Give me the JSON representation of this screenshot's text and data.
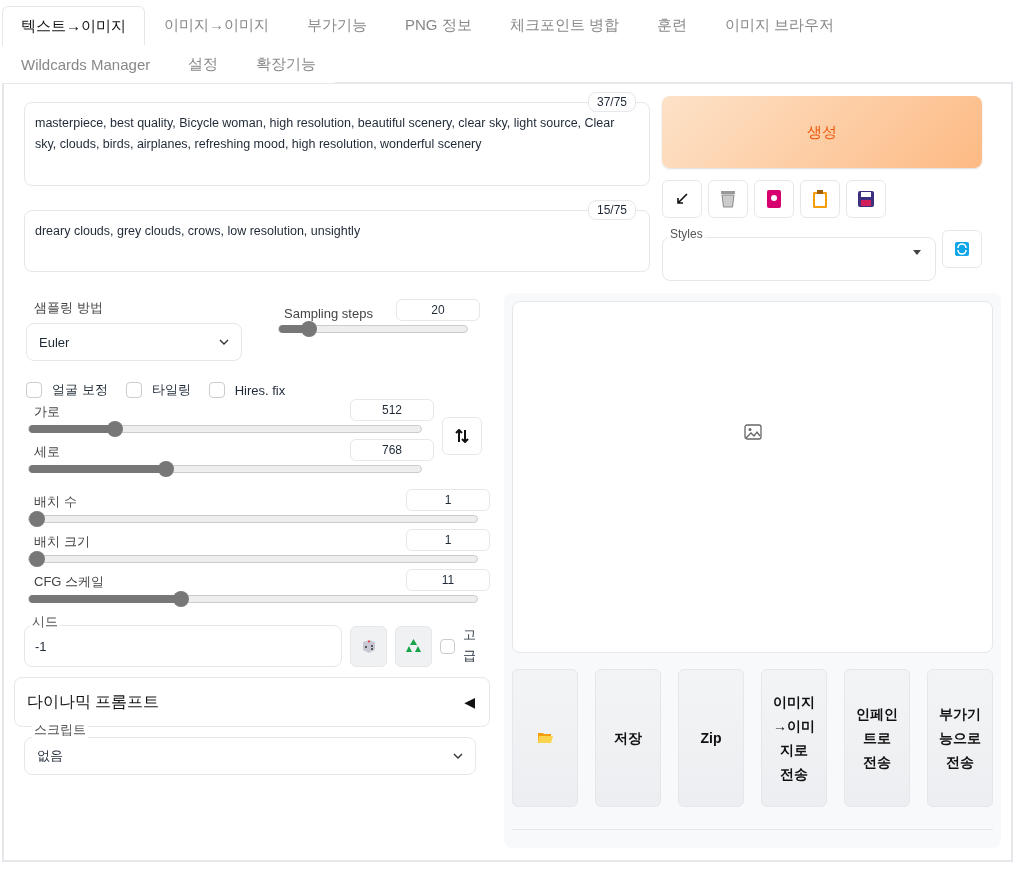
{
  "tabs": [
    {
      "label": "텍스트→이미지",
      "selected": true
    },
    {
      "label": "이미지→이미지",
      "selected": false
    },
    {
      "label": "부가기능",
      "selected": false
    },
    {
      "label": "PNG 정보",
      "selected": false
    },
    {
      "label": "체크포인트 병합",
      "selected": false
    },
    {
      "label": "훈련",
      "selected": false
    },
    {
      "label": "이미지 브라우저",
      "selected": false
    },
    {
      "label": "Wildcards Manager",
      "selected": false
    },
    {
      "label": "설정",
      "selected": false
    },
    {
      "label": "확장기능",
      "selected": false
    }
  ],
  "prompt": {
    "value": "masterpiece, best quality, Bicycle woman, high resolution, beautiful scenery, clear sky, light source, Clear sky, clouds, birds, airplanes, refreshing mood, high resolution, wonderful scenery",
    "count": "37/75"
  },
  "negative_prompt": {
    "value": "dreary clouds, grey clouds, crows, low resolution, unsightly",
    "count": "15/75"
  },
  "generate_button": "생성",
  "tool_buttons": [
    {
      "kind": "arrow"
    },
    {
      "kind": "trash"
    },
    {
      "kind": "card"
    },
    {
      "kind": "clipboard"
    },
    {
      "kind": "disk"
    }
  ],
  "styles": {
    "label": "Styles"
  },
  "sampling_method": {
    "label": "샘플링 방법",
    "value": "Euler"
  },
  "sampling_steps": {
    "label": "Sampling steps",
    "value": "20",
    "level": 0.16
  },
  "checkboxes": [
    {
      "label": "얼굴 보정",
      "checked": false
    },
    {
      "label": "타일링",
      "checked": false
    },
    {
      "label": "Hires. fix",
      "checked": false
    }
  ],
  "size_sliders": [
    {
      "label": "가로",
      "value": "512",
      "level": 0.22
    },
    {
      "label": "세로",
      "value": "768",
      "level": 0.35
    }
  ],
  "batch_sliders": [
    {
      "label": "배치 수",
      "value": "1",
      "level": 0
    },
    {
      "label": "배치 크기",
      "value": "1",
      "level": 0
    },
    {
      "label": "CFG 스케일",
      "value": "11",
      "level": 0.34
    }
  ],
  "seed": {
    "label": "시드",
    "value": "-1",
    "extra_label": "고급",
    "extra_checked": false
  },
  "dynamic_prompts": {
    "title": "다이나믹 프롬프트",
    "arrow": "◀",
    "expanded": false
  },
  "script": {
    "label": "스크립트",
    "value": "없음"
  },
  "output_buttons": [
    {
      "kind": "folder"
    },
    {
      "kind": "text",
      "label": "저장"
    },
    {
      "kind": "text",
      "label": "Zip"
    },
    {
      "kind": "text",
      "label": "이미지→이미지로 전송"
    },
    {
      "kind": "text",
      "label": "인페인트로 전송"
    },
    {
      "kind": "text",
      "label": "부가기능으로 전송"
    }
  ]
}
